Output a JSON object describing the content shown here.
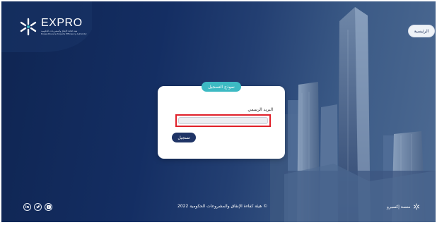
{
  "header": {
    "logo_text": "EXPRO",
    "logo_subtitle": "هيئة كفاءة الإنفاق والمشروعات الحكومية\nExpenditure & Projects Efficiency Authority",
    "home_button": "الرئيسية"
  },
  "login_form": {
    "title": "نموذج التسجيل",
    "email_label": "البريد الرسمي",
    "email_value": "",
    "email_placeholder": "",
    "submit_label": "تسجيل"
  },
  "footer": {
    "social": [
      {
        "icon": "linkedin-icon",
        "label": "in"
      },
      {
        "icon": "twitter-icon",
        "label": "t"
      },
      {
        "icon": "youtube-icon",
        "label": "▶"
      }
    ],
    "copyright": "© هيئة كفاءة الإنفاق والمشروعات الحكومية 2022",
    "platform_label": "منصة إكسبرو"
  },
  "colors": {
    "background": "#142e63",
    "accent": "#3dbac3",
    "button": "#1f3466",
    "highlight": "#e0202a"
  }
}
